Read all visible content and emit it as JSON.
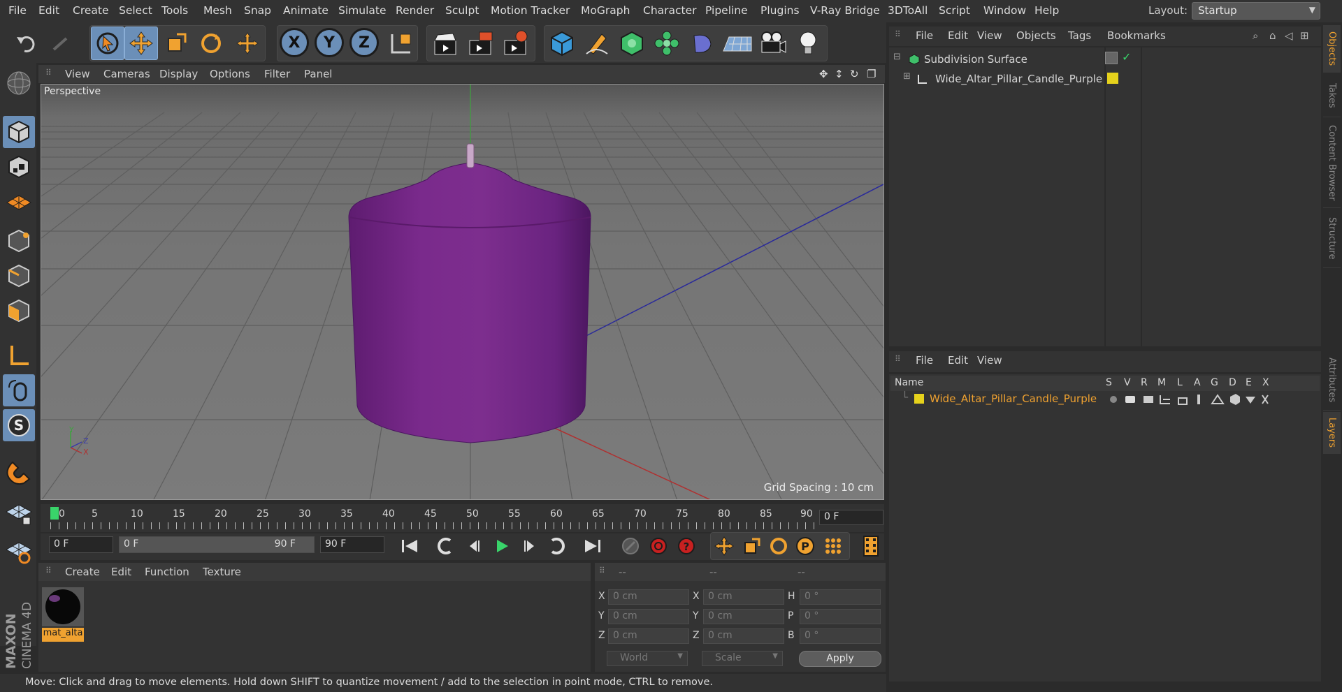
{
  "menubar": {
    "items": [
      "File",
      "Edit",
      "Create",
      "Select",
      "Tools",
      "Mesh",
      "Snap",
      "Animate",
      "Simulate",
      "Render",
      "Sculpt",
      "Motion Tracker",
      "MoGraph",
      "Character",
      "Pipeline",
      "Plugins",
      "V-Ray Bridge",
      "3DToAll",
      "Script",
      "Window",
      "Help"
    ],
    "layout_label": "Layout:",
    "layout_value": "Startup"
  },
  "toolbar": {
    "icons": [
      "undo-icon",
      "redo-icon",
      "live-selection-icon",
      "move-icon",
      "scale-icon",
      "rotate-icon",
      "transform-icon",
      "x-axis-icon",
      "y-axis-icon",
      "z-axis-icon",
      "coordinate-system-icon",
      "render-view-icon",
      "render-picture-viewer-icon",
      "render-settings-icon",
      "cube-icon",
      "pen-icon",
      "subdivision-icon",
      "cloner-icon",
      "deformer-icon",
      "floor-icon",
      "camera-icon",
      "light-icon"
    ],
    "axis_labels": [
      "X",
      "Y",
      "Z"
    ]
  },
  "viewport": {
    "menu": [
      "View",
      "Cameras",
      "Display",
      "Options",
      "Filter",
      "Panel"
    ],
    "label": "Perspective",
    "grid_spacing": "Grid Spacing : 10 cm",
    "axis_labels": {
      "y": "Y",
      "z": "Z",
      "x": "X"
    },
    "object_color": "#7a2a8c"
  },
  "timeline": {
    "ticks": [
      "0",
      "5",
      "10",
      "15",
      "20",
      "25",
      "30",
      "35",
      "40",
      "45",
      "50",
      "55",
      "60",
      "65",
      "70",
      "75",
      "80",
      "85",
      "90"
    ],
    "current_frame": "0 F",
    "start_field": "0 F",
    "range_start": "0 F",
    "range_end": "90 F",
    "end_field": "90 F"
  },
  "materials": {
    "menu": [
      "Create",
      "Edit",
      "Function",
      "Texture"
    ],
    "items": [
      {
        "name": "mat_alta"
      }
    ]
  },
  "coordinates": {
    "headers": [
      "--",
      "--",
      "--"
    ],
    "rows": [
      {
        "label1": "X",
        "value1": "0 cm",
        "label2": "X",
        "value2": "0 cm",
        "label3": "H",
        "value3": "0 °"
      },
      {
        "label1": "Y",
        "value1": "0 cm",
        "label2": "Y",
        "value2": "0 cm",
        "label3": "P",
        "value3": "0 °"
      },
      {
        "label1": "Z",
        "value1": "0 cm",
        "label2": "Z",
        "value2": "0 cm",
        "label3": "B",
        "value3": "0 °"
      }
    ],
    "mode": "World",
    "size_mode": "Scale",
    "apply": "Apply"
  },
  "status": "Move: Click and drag to move elements. Hold down SHIFT to quantize movement / add to the selection in point mode, CTRL to remove.",
  "objects": {
    "menu": [
      "File",
      "Edit",
      "View",
      "Objects",
      "Tags",
      "Bookmarks"
    ],
    "tree": [
      {
        "name": "Subdivision Surface",
        "level": 0
      },
      {
        "name": "Wide_Altar_Pillar_Candle_Purple",
        "level": 1
      }
    ]
  },
  "layers": {
    "menu": [
      "File",
      "Edit",
      "View"
    ],
    "header_name": "Name",
    "columns": [
      "S",
      "V",
      "R",
      "M",
      "L",
      "A",
      "G",
      "D",
      "E",
      "X"
    ],
    "rows": [
      {
        "name": "Wide_Altar_Pillar_Candle_Purple",
        "color": "#e6d21c"
      }
    ]
  },
  "side_tabs": [
    "Objects",
    "Takes",
    "Content Browser",
    "Structure",
    "Attributes",
    "Layers"
  ],
  "brand": {
    "maxon": "MAXON",
    "product": "CINEMA 4D"
  },
  "colors": {
    "accent": "#6b8fb8",
    "highlight": "#f0a230",
    "layer_color": "#e6d21c"
  }
}
